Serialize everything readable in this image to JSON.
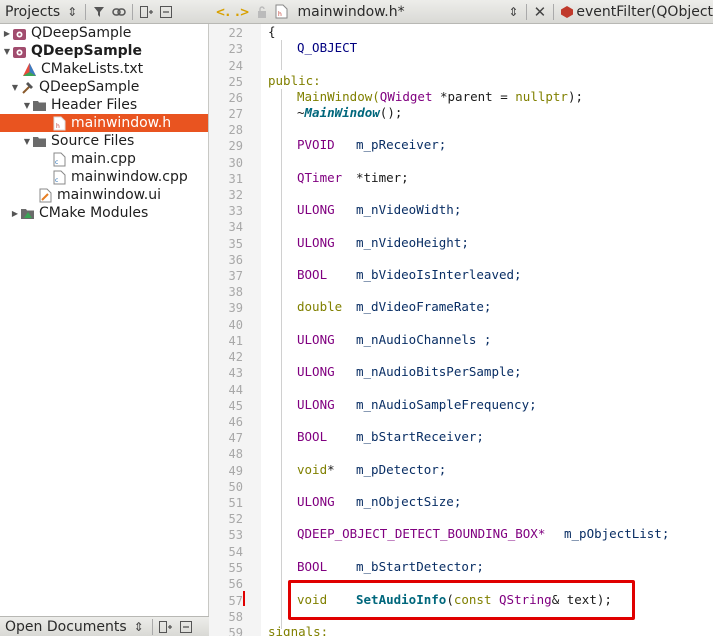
{
  "projects_panel": {
    "title": "Projects",
    "tree": [
      {
        "label": "QDeepSample",
        "bold": false
      },
      {
        "label": "QDeepSample",
        "bold": true
      },
      {
        "label": "CMakeLists.txt"
      },
      {
        "label": "QDeepSample"
      },
      {
        "label": "Header Files"
      },
      {
        "label": "mainwindow.h",
        "selected": true
      },
      {
        "label": "Source Files"
      },
      {
        "label": "main.cpp"
      },
      {
        "label": "mainwindow.cpp"
      },
      {
        "label": "mainwindow.ui"
      },
      {
        "label": "CMake Modules"
      }
    ],
    "open_documents": "Open Documents"
  },
  "editor_toolbar": {
    "file_name": "mainwindow.h*",
    "symbol": "eventFilter(QObject"
  },
  "code": {
    "line_numbers": [
      "22",
      "23",
      "24",
      "25",
      "26",
      "27",
      "28",
      "29",
      "30",
      "31",
      "32",
      "33",
      "34",
      "35",
      "36",
      "37",
      "38",
      "39",
      "40",
      "41",
      "42",
      "43",
      "44",
      "45",
      "46",
      "47",
      "48",
      "49",
      "50",
      "51",
      "52",
      "53",
      "54",
      "55",
      "56",
      "57",
      "58",
      "59"
    ],
    "l22": "{",
    "l23": "Q_OBJECT",
    "l25": "public:",
    "l26_a": "MainWindow(",
    "l26_b": "QWidget",
    "l26_c": " *parent = ",
    "l26_d": "nullptr",
    "l26_e": ");",
    "l27_a": "~",
    "l27_b": "MainWindow",
    "l27_c": "();",
    "m1_t": "PVOID",
    "m1_n": "m_pReceiver;",
    "m2_t": "QTimer",
    "m2_n": "*timer;",
    "m3_t": "ULONG",
    "m3_n": "m_nVideoWidth;",
    "m4_t": "ULONG",
    "m4_n": "m_nVideoHeight;",
    "m5_t": "BOOL",
    "m5_n": "m_bVideoIsInterleaved;",
    "m6_t": "double",
    "m6_n": "m_dVideoFrameRate;",
    "m7_t": "ULONG",
    "m7_n": "m_nAudioChannels ;",
    "m8_t": "ULONG",
    "m8_n": "m_nAudioBitsPerSample;",
    "m9_t": "ULONG",
    "m9_n": "m_nAudioSampleFrequency;",
    "m10_t": "BOOL",
    "m10_n": "m_bStartReceiver;",
    "m11_t": "void",
    "m11_s": "*",
    "m11_n": "m_pDetector;",
    "m12_t": "ULONG",
    "m12_n": "m_nObjectSize;",
    "m13_t": "QDEEP_OBJECT_DETECT_BOUNDING_BOX*",
    "m13_n": "m_pObjectList;",
    "m14_t": "BOOL",
    "m14_n": "m_bStartDetector;",
    "l57_t": "void",
    "l57_f": "SetAudioInfo",
    "l57_a": "(",
    "l57_k": "const",
    "l57_q": "QString",
    "l57_r": "& text);",
    "l59": "signals:"
  },
  "colors": {
    "selection": "#e95420",
    "highlight_box": "#e00000"
  }
}
